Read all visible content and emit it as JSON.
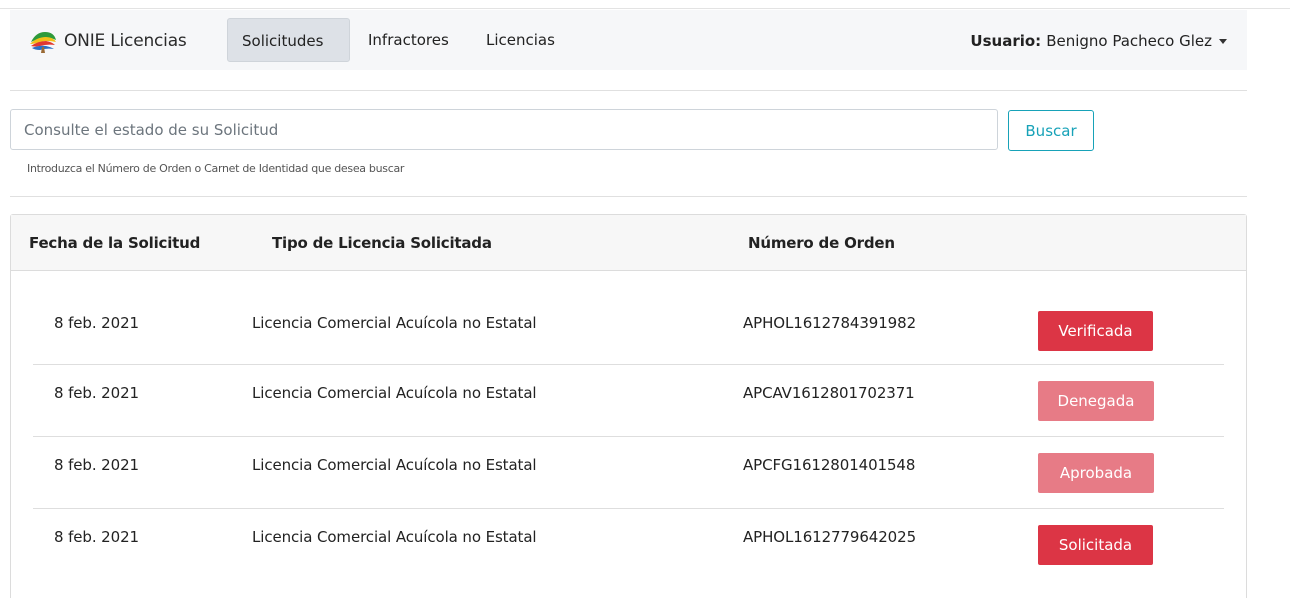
{
  "navbar": {
    "brand": "ONIE Licencias",
    "links": [
      "Solicitudes",
      "Infractores",
      "Licencias"
    ],
    "user_label": "Usuario:",
    "user_name": "Benigno Pacheco Glez"
  },
  "search": {
    "placeholder": "Consulte el estado de su Solicitud",
    "button": "Buscar",
    "help": "Introduzca el Número de Orden o Carnet de Identidad que desea buscar"
  },
  "table": {
    "headers": [
      "Fecha de la Solicitud",
      "Tipo de Licencia Solicitada",
      "Número de Orden"
    ],
    "rows": [
      {
        "date": "8 feb. 2021",
        "type": "Licencia Comercial Acuícola no Estatal",
        "order": "APHOL1612784391982",
        "status": "Verificada"
      },
      {
        "date": "8 feb. 2021",
        "type": "Licencia Comercial Acuícola no Estatal",
        "order": "APCAV1612801702371",
        "status": "Denegada"
      },
      {
        "date": "8 feb. 2021",
        "type": "Licencia Comercial Acuícola no Estatal",
        "order": "APCFG1612801401548",
        "status": "Aprobada"
      },
      {
        "date": "8 feb. 2021",
        "type": "Licencia Comercial Acuícola no Estatal",
        "order": "APHOL1612779642025",
        "status": "Solicitada"
      }
    ]
  },
  "colors": {
    "badge_dark": "#dc3545",
    "badge_light": "#e77b86",
    "accent": "#17a2b8"
  }
}
